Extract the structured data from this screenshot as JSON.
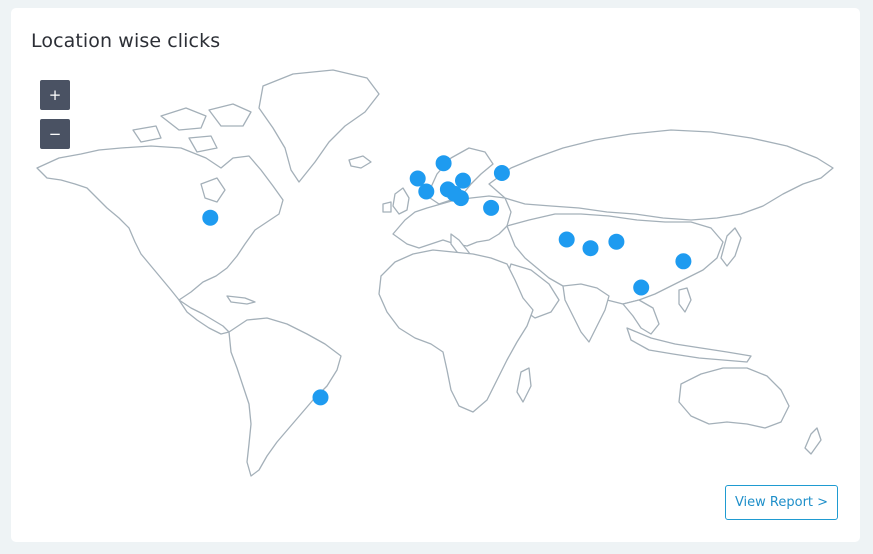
{
  "card": {
    "title": "Location wise clicks"
  },
  "zoom": {
    "in_label": "+",
    "out_label": "−"
  },
  "map": {
    "marker_color": "#1e9bf0",
    "land_stroke": "#a4b0b9",
    "markers": [
      {
        "name": "united-states",
        "lon": -98,
        "lat": 35
      },
      {
        "name": "brazil",
        "lon": -47,
        "lat": -23.5
      },
      {
        "name": "united-kingdom",
        "lon": -2,
        "lat": 53
      },
      {
        "name": "france",
        "lon": 2,
        "lat": 47
      },
      {
        "name": "norway",
        "lon": 10,
        "lat": 60
      },
      {
        "name": "poland",
        "lon": 19,
        "lat": 52
      },
      {
        "name": "russia",
        "lon": 37,
        "lat": 55.5
      },
      {
        "name": "germany-south",
        "lon": 12,
        "lat": 48
      },
      {
        "name": "austria",
        "lon": 15,
        "lat": 46
      },
      {
        "name": "balkans",
        "lon": 18,
        "lat": 44
      },
      {
        "name": "turkey",
        "lon": 32,
        "lat": 39.5
      },
      {
        "name": "pakistan",
        "lon": 67,
        "lat": 25
      },
      {
        "name": "india-west",
        "lon": 78,
        "lat": 21
      },
      {
        "name": "bangladesh",
        "lon": 90,
        "lat": 24
      },
      {
        "name": "philippines",
        "lon": 121,
        "lat": 15
      },
      {
        "name": "malaysia",
        "lon": 101.5,
        "lat": 3
      }
    ]
  },
  "actions": {
    "view_report_label": "View Report >"
  }
}
